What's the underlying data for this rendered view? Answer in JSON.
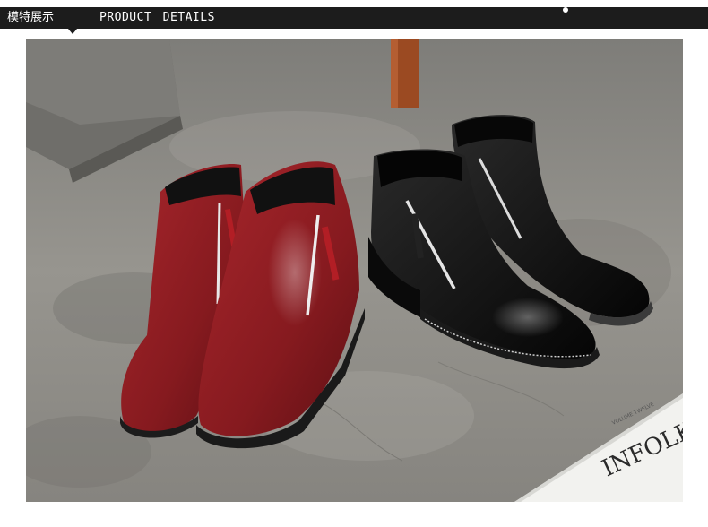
{
  "header": {
    "title_cn": "模特展示",
    "title_en": "PRODUCT  DETAILS"
  },
  "photo": {
    "subject": "two pairs of zip-side ankle boots",
    "pairs": [
      {
        "color_name": "wine red",
        "color": "#8b1a1f"
      },
      {
        "color_name": "black",
        "color": "#151515"
      }
    ],
    "magazine_text": "INFOLK",
    "magazine_small_text": "VOLUME TWELVE"
  },
  "colors": {
    "header_bg": "#1c1c1c",
    "header_text": "#ffffff",
    "floor": "#8d8c87",
    "wood_leg": "#9b4a22"
  }
}
